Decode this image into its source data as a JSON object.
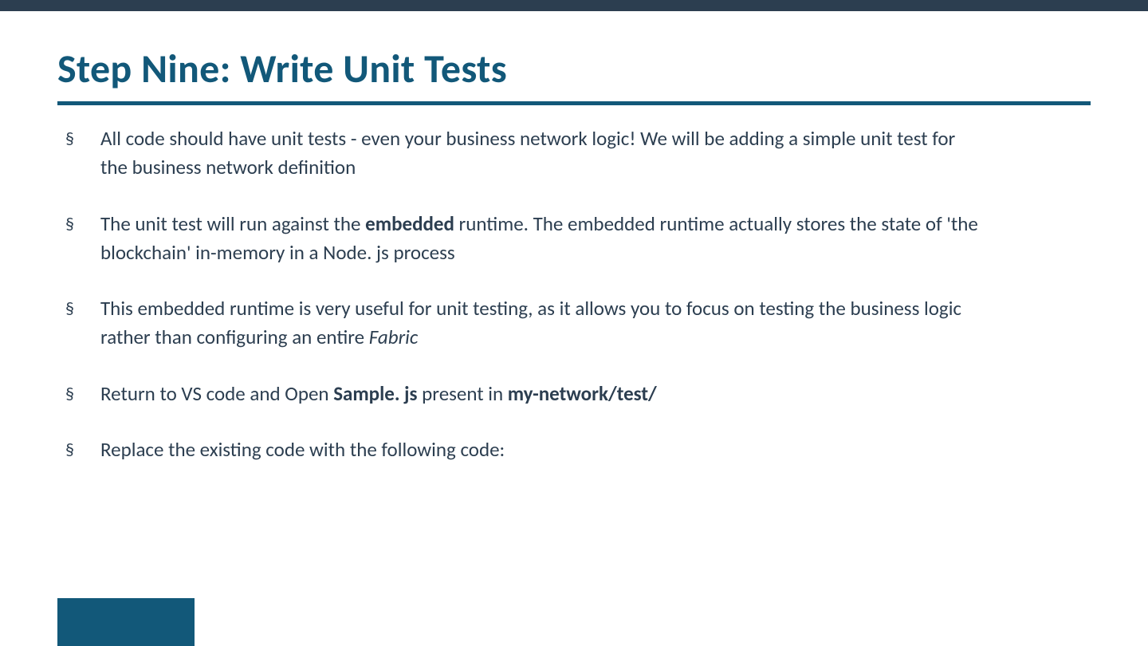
{
  "title": "Step Nine: Write Unit Tests",
  "bullets": [
    {
      "pre1": "All code should have unit tests - even your business network logic! We will be adding a simple unit test for",
      "post1": "the business network definition"
    },
    {
      "pre1": "The unit test will run against the ",
      "bold1": "embedded",
      "mid1": " runtime. The embedded runtime actually stores the state of  'the",
      "post1": "blockchain' in-memory in a Node. js process"
    },
    {
      "pre1": "This embedded runtime is very useful for unit testing, as it allows you to focus on testing the business logic",
      "post1_pre": "rather than configuring an entire ",
      "post1_italic": "Fabric"
    },
    {
      "pre1": "Return to VS code and Open ",
      "bold1": "Sample. js",
      "mid1": " present in ",
      "bold2": "my-network/test/"
    },
    {
      "pre1": "Replace the existing code with the following code:"
    }
  ]
}
